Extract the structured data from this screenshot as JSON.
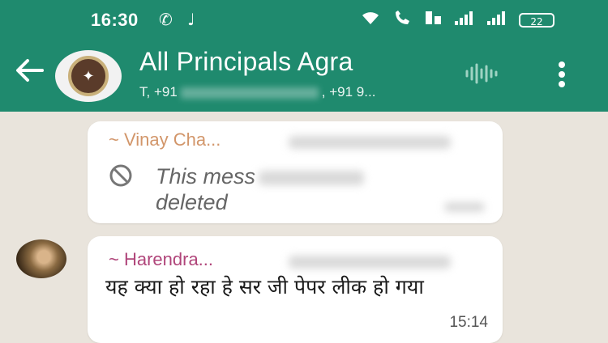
{
  "status_bar": {
    "time": "16:30",
    "left_icons": [
      "whatsapp-icon",
      "music-note-icon"
    ],
    "right_icons": [
      "wifi-icon",
      "wifi-call-icon",
      "volte-icon",
      "signal-1-icon",
      "signal-2-icon"
    ],
    "battery": "22"
  },
  "chat_header": {
    "back_icon": "arrow-left-icon",
    "group_name": "All Principals Agra",
    "members_prefix": "T, +91",
    "members_suffix": ", +91 9...",
    "voice_icon": "audio-wave-icon",
    "menu_icon": "more-vertical-icon"
  },
  "messages": [
    {
      "sender": "~ Vinay Cha...",
      "deleted_icon": "ban-icon",
      "text": "This message was deleted",
      "text_visible": "This mess",
      "text_visible_line2": "deleted"
    },
    {
      "sender": "~ Harendra...",
      "text": "यह क्या हो रहा हे सर जी पेपर लीक हो गया",
      "time": "15:14"
    }
  ],
  "colors": {
    "header_bg": "#1f8a6e",
    "chat_bg": "#e9e4dc",
    "sender_1": "#d2966a",
    "sender_2": "#b0457a"
  }
}
